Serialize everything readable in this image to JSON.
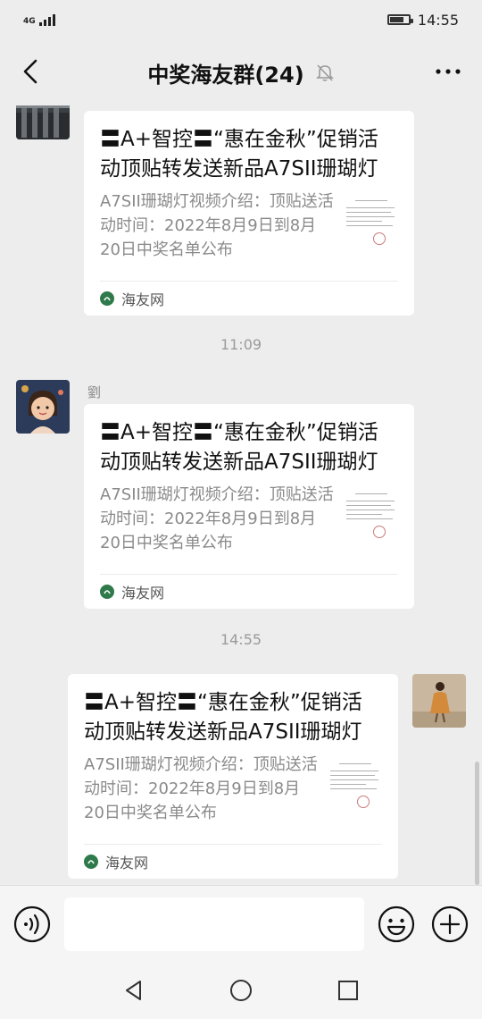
{
  "status_bar": {
    "network": "4G",
    "time": "14:55",
    "battery_level": 0.75
  },
  "header": {
    "title": "中奖海友群(24)",
    "mute_icon": "bell-off-icon",
    "back_icon": "chevron-left-icon",
    "more_icon": "more-dots-icon"
  },
  "messages": [
    {
      "type": "link-card",
      "side": "left",
      "sender": "",
      "card": {
        "title": "〓A+智控〓“惠在金秋”促销活动顶贴转发送新品A7SII珊瑚灯",
        "description": "A7SII珊瑚灯视频介绍：顶贴送活动时间：2022年8月9日到8月20日中奖名单公布",
        "source": "海友网"
      }
    },
    {
      "type": "timestamp",
      "text": "11:09"
    },
    {
      "type": "link-card",
      "side": "left",
      "sender": "劉",
      "card": {
        "title": "〓A+智控〓“惠在金秋”促销活动顶贴转发送新品A7SII珊瑚灯",
        "description": "A7SII珊瑚灯视频介绍：顶贴送活动时间：2022年8月9日到8月20日中奖名单公布",
        "source": "海友网"
      }
    },
    {
      "type": "timestamp",
      "text": "14:55"
    },
    {
      "type": "link-card",
      "side": "right",
      "sender": "",
      "card": {
        "title": "〓A+智控〓“惠在金秋”促销活动顶贴转发送新品A7SII珊瑚灯",
        "description": "A7SII珊瑚灯视频介绍：顶贴送活动时间：2022年8月9日到8月20日中奖名单公布",
        "source": "海友网"
      }
    }
  ],
  "input_bar": {
    "voice_icon": "voice-icon",
    "input_value": "",
    "emoji_icon": "emoji-icon",
    "plus_icon": "plus-icon"
  },
  "system_nav": {
    "back_icon": "triangle-back-icon",
    "home_icon": "circle-home-icon",
    "recents_icon": "square-recents-icon"
  }
}
